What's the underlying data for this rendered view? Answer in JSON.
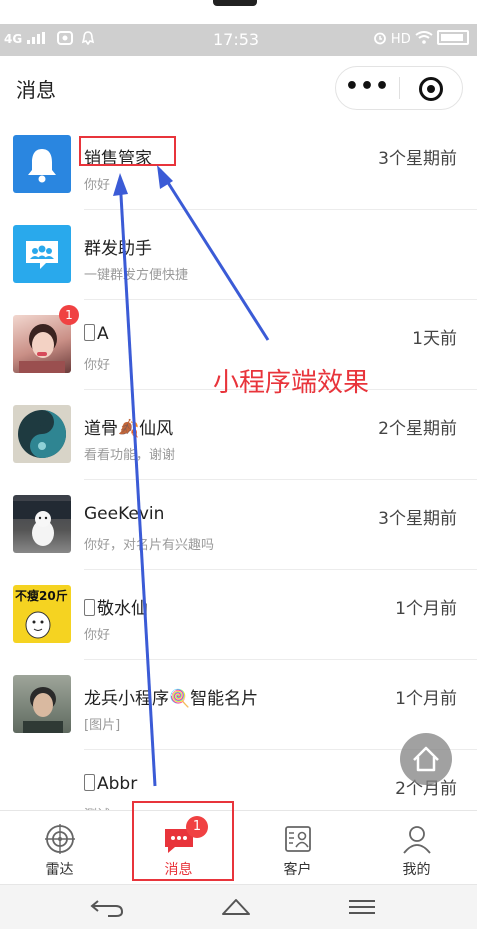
{
  "status_bar": {
    "network": "4G",
    "time": "17:53",
    "hd": "HD"
  },
  "nav": {
    "title": "消息",
    "more_glyph": "•••"
  },
  "conversations": [
    {
      "name": "销售管家",
      "preview": "你好",
      "time": "3个星期前",
      "badge": "",
      "avatar_icon": "bell-icon",
      "avatar_color": "#2a86e0"
    },
    {
      "name": "群发助手",
      "preview": "一键群发方便快捷",
      "time": "",
      "badge": "",
      "avatar_icon": "group-chat-icon",
      "avatar_color": "#29a9ec"
    },
    {
      "name": "A",
      "preview": "你好",
      "time": "1天前",
      "badge": "1",
      "avatar_icon": "user-photo-avatar",
      "phone_prefix": true
    },
    {
      "name": "道骨🍂仙风",
      "preview": "看看功能，谢谢",
      "time": "2个星期前",
      "badge": "",
      "avatar_icon": "yin-yang-avatar"
    },
    {
      "name": "GeeKevin",
      "preview": "你好，对名片有兴趣吗",
      "time": "3个星期前",
      "badge": "",
      "avatar_icon": "dog-photo-avatar"
    },
    {
      "name": "敬水仙",
      "preview": "你好",
      "time": "1个月前",
      "badge": "",
      "avatar_icon": "meme-avatar",
      "phone_prefix": true,
      "avatar_text": "不瘦20斤"
    },
    {
      "name": "龙兵小程序🍭智能名片",
      "preview": "[图片]",
      "time": "1个月前",
      "badge": "",
      "avatar_icon": "man-photo-avatar"
    },
    {
      "name": "Abbr",
      "preview": "测试",
      "time": "2个月前",
      "badge": "",
      "avatar_icon": "blank-avatar",
      "phone_prefix": true
    }
  ],
  "annotation": {
    "text": "小程序端效果",
    "color": "#e8343b"
  },
  "tabbar": {
    "tabs": [
      {
        "label": "雷达",
        "icon": "radar-icon",
        "active": false
      },
      {
        "label": "消息",
        "icon": "message-icon",
        "active": true,
        "badge": "1"
      },
      {
        "label": "客户",
        "icon": "contact-card-icon",
        "active": false
      },
      {
        "label": "我的",
        "icon": "person-icon",
        "active": false
      }
    ]
  },
  "colors": {
    "accent_red": "#e8343b",
    "badge_red": "#f04142",
    "arrow_blue": "#3b5bd6"
  }
}
